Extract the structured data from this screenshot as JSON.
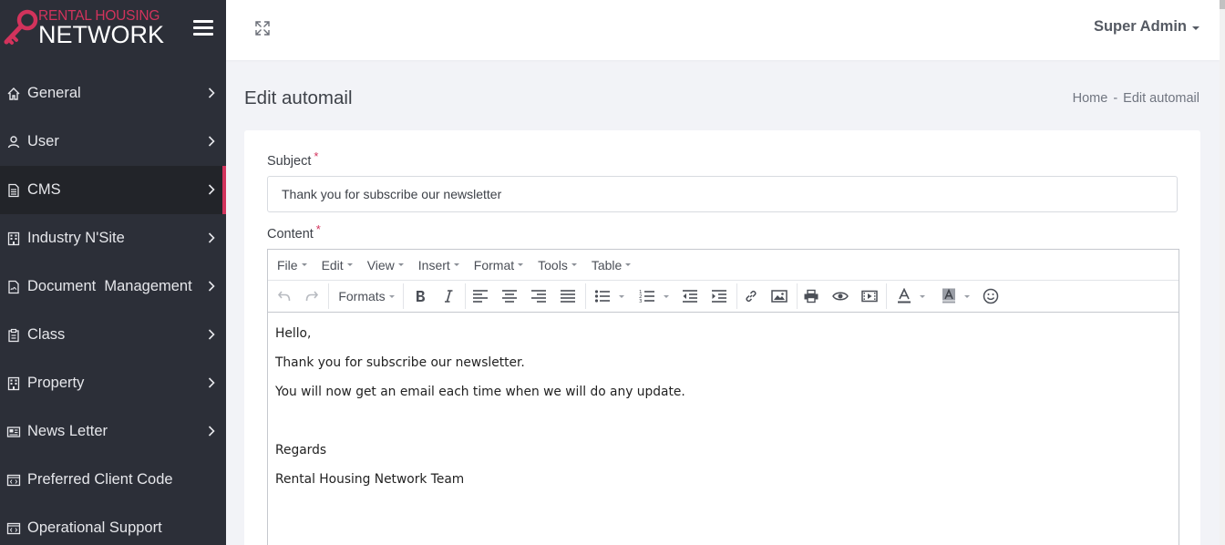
{
  "brand": {
    "line1": "RENTAL HOUSING",
    "line2": "NETWORK",
    "accent_color": "#d2335c"
  },
  "sidebar": {
    "items": [
      {
        "label": "General",
        "icon": "home-icon"
      },
      {
        "label": "User",
        "icon": "user-icon"
      },
      {
        "label": "CMS",
        "icon": "document-icon",
        "active": true
      },
      {
        "label": "Industry N'Site",
        "icon": "building-icon"
      },
      {
        "label": "Document  Management",
        "icon": "file-signature-icon"
      },
      {
        "label": "Class",
        "icon": "clipboard-icon"
      },
      {
        "label": "Property",
        "icon": "building-icon"
      },
      {
        "label": "News Letter",
        "icon": "newspaper-icon"
      },
      {
        "label": "Preferred Client Code",
        "icon": "code-window-icon"
      },
      {
        "label": "Operational Support",
        "icon": "code-window-icon"
      }
    ]
  },
  "header": {
    "user_name": "Super Admin"
  },
  "page": {
    "title": "Edit automail",
    "breadcrumb": [
      "Home",
      "-",
      "Edit automail"
    ]
  },
  "form": {
    "subject_label": "Subject",
    "required_mark": "*",
    "subject_value": "Thank you for subscribe our newsletter",
    "content_label": "Content"
  },
  "editor": {
    "menus": [
      "File",
      "Edit",
      "View",
      "Insert",
      "Format",
      "Tools",
      "Table"
    ],
    "formats_label": "Formats",
    "content_lines": [
      "Hello,",
      "Thank you for subscribe our newsletter.",
      "You will now get an email each time when we will do any update.",
      "",
      "Regards",
      "Rental Housing Network Team"
    ]
  }
}
